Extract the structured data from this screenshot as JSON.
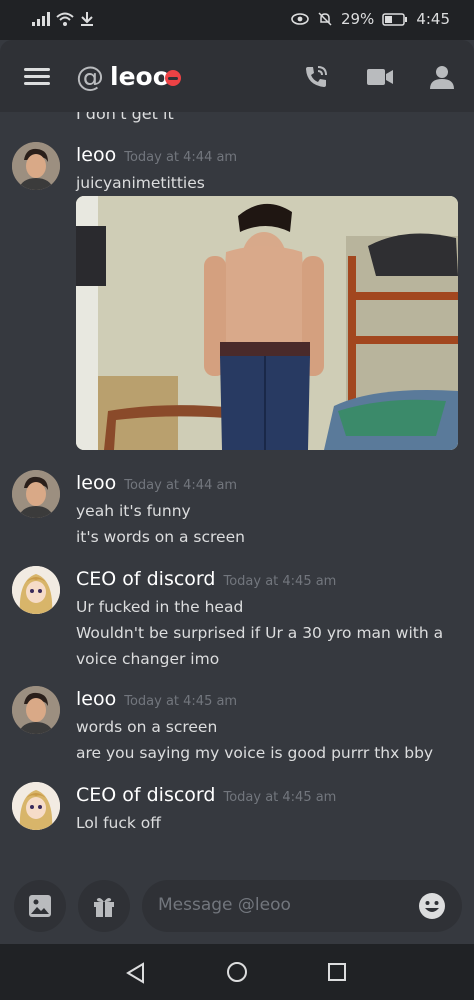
{
  "status_bar": {
    "battery": "29%",
    "time": "4:45"
  },
  "header": {
    "at_symbol": "@",
    "title": "leoo"
  },
  "chat": {
    "cut_off_text": "I don't get it",
    "messages": [
      {
        "author": "leoo",
        "time": "Today at 4:44 am",
        "lines": [
          "juicyanimetitties"
        ],
        "has_image": true
      },
      {
        "author": "leoo",
        "time": "Today at 4:44 am",
        "lines": [
          "yeah it's funny",
          "it's words on a screen"
        ]
      },
      {
        "author": "CEO of discord",
        "time": "Today at 4:45 am",
        "lines": [
          "Ur fucked in the head",
          "Wouldn't be surprised if Ur a 30 yro man with a",
          "voice changer imo"
        ]
      },
      {
        "author": "leoo",
        "time": "Today at 4:45 am",
        "lines": [
          "words on a screen",
          "are you saying my voice is good purrr thx bby"
        ]
      },
      {
        "author": "CEO of discord",
        "time": "Today at 4:45 am",
        "lines": [
          "Lol fuck off"
        ]
      }
    ]
  },
  "composer": {
    "placeholder": "Message @leoo"
  },
  "colors": {
    "background": "#36393f",
    "header": "#2f3136",
    "dnd_status": "#ed4245"
  },
  "icons": [
    "signal-icon",
    "wifi-icon",
    "download-icon",
    "eye-icon",
    "mute-icon",
    "battery-icon",
    "menu-icon",
    "call-icon",
    "video-icon",
    "members-icon",
    "image-icon",
    "gift-icon",
    "emoji-icon",
    "back-icon",
    "home-icon",
    "recents-icon"
  ]
}
